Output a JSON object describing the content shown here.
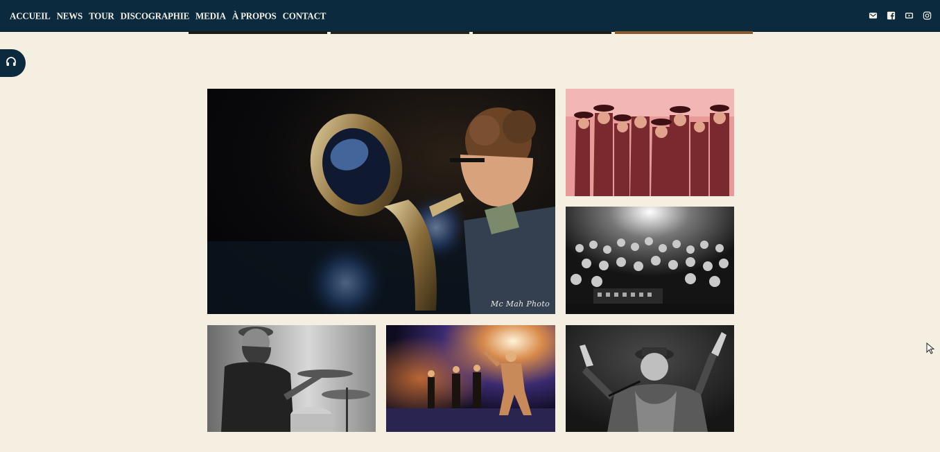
{
  "nav": {
    "items": [
      {
        "label": "ACCUEIL"
      },
      {
        "label": "NEWS"
      },
      {
        "label": "TOUR"
      },
      {
        "label": "DISCOGRAPHIE"
      },
      {
        "label": "MEDIA"
      },
      {
        "label": "À PROPOS"
      },
      {
        "label": "CONTACT"
      }
    ]
  },
  "social": {
    "icons": [
      "email-icon",
      "facebook-icon",
      "youtube-icon",
      "instagram-icon"
    ]
  },
  "audio_player": {
    "icon": "headphones-icon"
  },
  "gallery": {
    "photos": [
      {
        "subject": "tuba-player-concert",
        "credit": "Mc Mah Photo"
      },
      {
        "subject": "band-group-portrait"
      },
      {
        "subject": "concert-crowd"
      },
      {
        "subject": "drummer"
      },
      {
        "subject": "band-on-stage"
      },
      {
        "subject": "singer-performing"
      }
    ]
  },
  "colors": {
    "nav_background": "#0b2a3d",
    "page_background": "#f5efe1",
    "nav_text": "#f3efe6"
  }
}
